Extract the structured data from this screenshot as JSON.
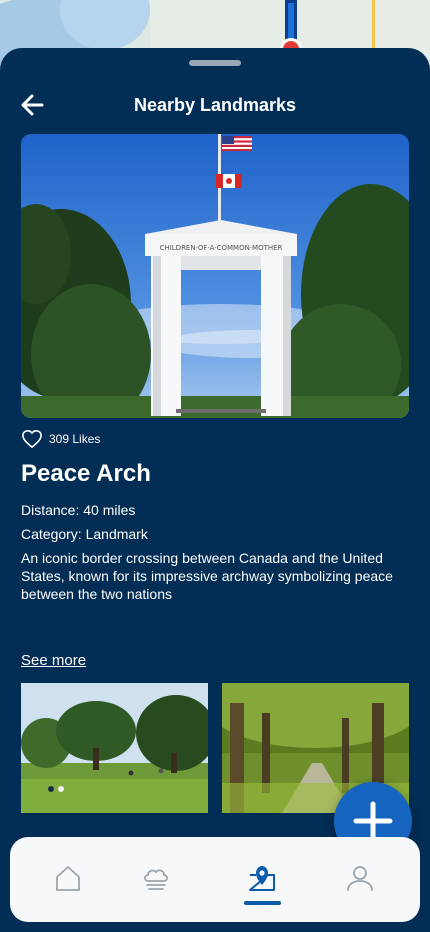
{
  "header": {
    "title": "Nearby Landmarks",
    "back_icon": "arrow-left-icon"
  },
  "landmark": {
    "likes": "309 Likes",
    "name": "Peace Arch",
    "distance": "Distance: 40 miles",
    "category": "Category: Landmark",
    "description": "An iconic border crossing between Canada and the United States, known for its impressive archway symbolizing peace between the two nations",
    "see_more": "See more",
    "hero_inscription": "CHILDREN·OF·A·COMMON·MOTHER"
  },
  "actions": {
    "add_icon": "plus-icon"
  },
  "tabs": [
    {
      "icon": "home-icon",
      "active": false
    },
    {
      "icon": "cloud-icon",
      "active": false
    },
    {
      "icon": "map-pin-icon",
      "active": true
    },
    {
      "icon": "user-icon",
      "active": false
    }
  ],
  "colors": {
    "sheet_background": "#022d55",
    "accent": "#1565c0",
    "tab_active": "#0b5cab",
    "tab_inactive": "#9aa4ad"
  }
}
